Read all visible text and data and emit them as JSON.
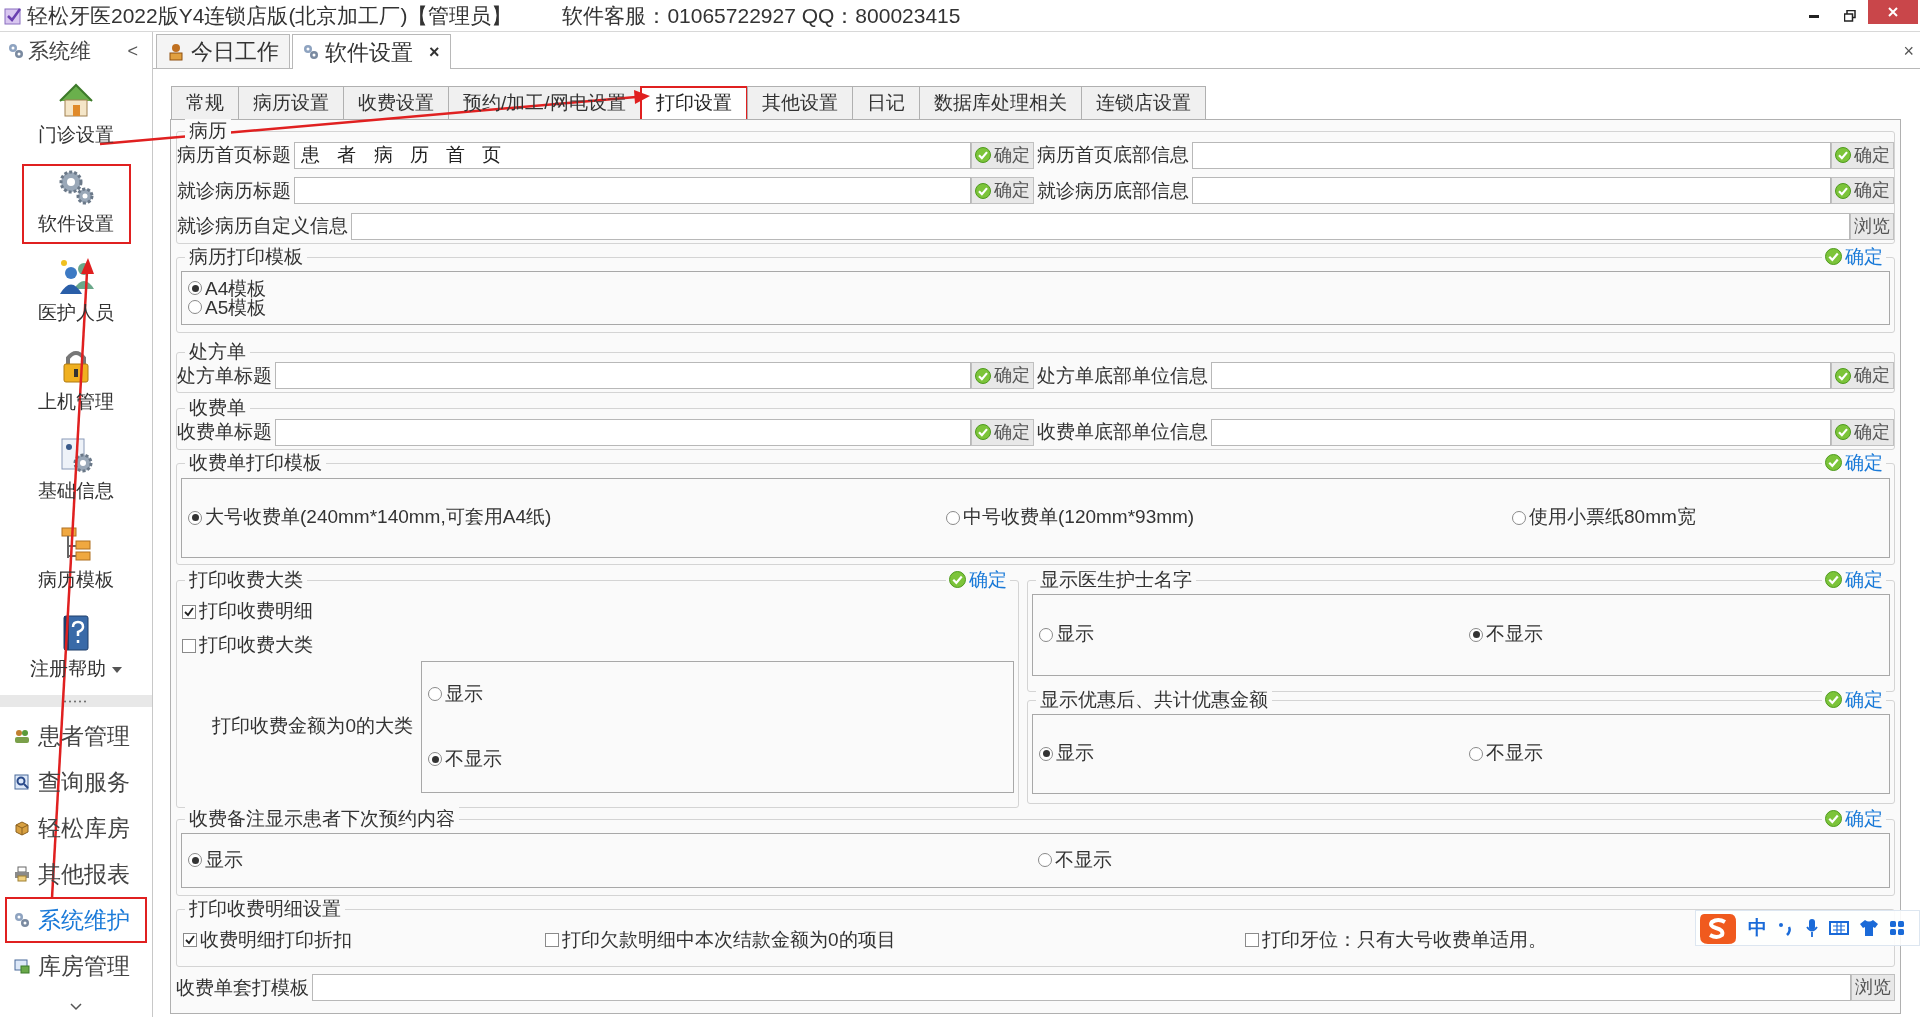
{
  "window": {
    "title": "轻松牙医2022版Y4连锁店版(北京加工厂)【管理员】",
    "support": "软件客服：01065722927 QQ：800023415"
  },
  "left_panel": {
    "title": "系统维",
    "collapse": "<",
    "modules": [
      {
        "label": "门诊设置",
        "highlighted": false
      },
      {
        "label": "软件设置",
        "highlighted": true
      },
      {
        "label": "医护人员",
        "highlighted": false
      },
      {
        "label": "上机管理",
        "highlighted": false
      },
      {
        "label": "基础信息",
        "highlighted": false
      },
      {
        "label": "病历模板",
        "highlighted": false
      },
      {
        "label": "注册帮助",
        "highlighted": false,
        "has_menu": true
      }
    ],
    "nav": [
      {
        "label": "患者管理",
        "selected": false,
        "highlighted": false
      },
      {
        "label": "查询服务",
        "selected": false,
        "highlighted": false
      },
      {
        "label": "轻松库房",
        "selected": false,
        "highlighted": false
      },
      {
        "label": "其他报表",
        "selected": false,
        "highlighted": false
      },
      {
        "label": "系统维护",
        "selected": true,
        "highlighted": true
      },
      {
        "label": "库房管理",
        "selected": false,
        "highlighted": false
      }
    ]
  },
  "doc_tabs": [
    {
      "label": "今日工作",
      "selected": false
    },
    {
      "label": "软件设置",
      "selected": true,
      "close": "×"
    }
  ],
  "close_all": "×",
  "settings_tabs": [
    {
      "label": "常规",
      "selected": false,
      "highlighted": false
    },
    {
      "label": "病历设置",
      "selected": false,
      "highlighted": false
    },
    {
      "label": "收费设置",
      "selected": false,
      "highlighted": false
    },
    {
      "label": "预约/加工/网电设置",
      "selected": false,
      "highlighted": false
    },
    {
      "label": "打印设置",
      "selected": true,
      "highlighted": true
    },
    {
      "label": "其他设置",
      "selected": false,
      "highlighted": false
    },
    {
      "label": "日记",
      "selected": false,
      "highlighted": false
    },
    {
      "label": "数据库处理相关",
      "selected": false,
      "highlighted": false
    },
    {
      "label": "连锁店设置",
      "selected": false,
      "highlighted": false
    }
  ],
  "record": {
    "title": "病历",
    "rows": [
      [
        {
          "label": "病历首页标题",
          "value": "患 者 病 历 首 页",
          "confirm": "确定"
        },
        {
          "label": "病历首页底部信息",
          "confirm": "确定"
        }
      ],
      [
        {
          "label": "就诊病历标题",
          "confirm": "确定"
        },
        {
          "label": "就诊病历底部信息",
          "confirm": "确定"
        }
      ],
      [
        {
          "label": "就诊病历自定义信息",
          "browse": "浏览"
        }
      ]
    ]
  },
  "record_template": {
    "title": "病历打印模板",
    "confirm": "确定",
    "options": [
      {
        "label": "A4模板",
        "selected": true
      },
      {
        "label": "A5模板",
        "selected": false
      }
    ]
  },
  "prescription": {
    "title": "处方单",
    "rows": [
      [
        {
          "label": "处方单标题",
          "confirm": "确定"
        },
        {
          "label": "处方单底部单位信息",
          "confirm": "确定"
        }
      ]
    ]
  },
  "receipt": {
    "title": "收费单",
    "rows": [
      [
        {
          "label": "收费单标题",
          "confirm": "确定"
        },
        {
          "label": "收费单底部单位信息",
          "confirm": "确定"
        }
      ]
    ]
  },
  "receipt_template": {
    "title": "收费单打印模板",
    "confirm": "确定",
    "options": [
      {
        "label": "大号收费单(240mm*140mm,可套用A4纸)",
        "selected": true
      },
      {
        "label": "中号收费单(120mm*93mm)",
        "selected": false
      },
      {
        "label": "使用小票纸80mm宽",
        "selected": false
      }
    ]
  },
  "fee_categories": {
    "title": "打印收费大类",
    "confirm": "确定",
    "checks": [
      {
        "label": "打印收费明细",
        "checked": true
      },
      {
        "label": "打印收费大类",
        "checked": false
      }
    ],
    "zero_label": "打印收费金额为0的大类",
    "zero_options": [
      {
        "label": "显示",
        "selected": false
      },
      {
        "label": "不显示",
        "selected": true
      }
    ]
  },
  "show_names": {
    "title": "显示医生护士名字",
    "confirm": "确定",
    "options": [
      {
        "label": "显示",
        "selected": false
      },
      {
        "label": "不显示",
        "selected": true
      }
    ]
  },
  "show_discount": {
    "title": "显示优惠后、共计优惠金额",
    "confirm": "确定",
    "options": [
      {
        "label": "显示",
        "selected": true
      },
      {
        "label": "不显示",
        "selected": false
      }
    ]
  },
  "remark": {
    "title": "收费备注显示患者下次预约内容",
    "confirm": "确定",
    "options": [
      {
        "label": "显示",
        "selected": true
      },
      {
        "label": "不显示",
        "selected": false
      }
    ]
  },
  "detail_settings": {
    "title": "打印收费明细设置",
    "checks": [
      {
        "label": "收费明细打印折扣",
        "checked": true
      },
      {
        "label": "打印欠款明细中本次结款金额为0的项目",
        "checked": false
      },
      {
        "label": "打印牙位：只有大号收费单适用。",
        "checked": false
      }
    ],
    "field": {
      "label": "收费单套打模板",
      "browse": "浏览"
    }
  },
  "ime_toolbar": {
    "mode": "中"
  }
}
